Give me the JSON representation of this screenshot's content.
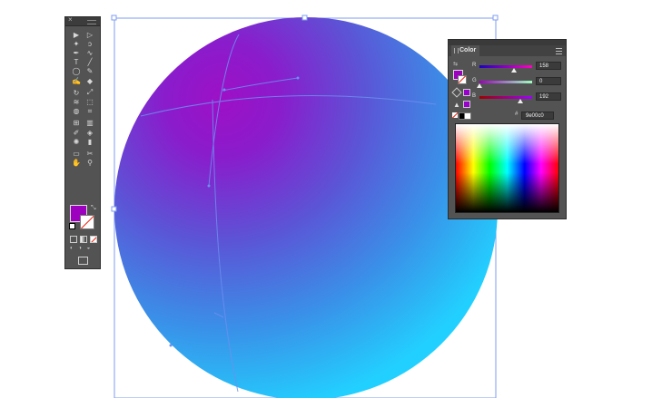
{
  "app": "Illustrator-style vector editor",
  "colors": {
    "fill": "#9e00c0",
    "gradient_highlight": "#9e10c6",
    "gradient_mid": "#5b55d6",
    "gradient_edge": "#28c4ff",
    "selection": "#5b8cf0"
  },
  "toolbar": {
    "close_glyph": "×",
    "tools": [
      "selection-tool",
      "direct-selection-tool",
      "magic-wand-tool",
      "lasso-tool",
      "pen-tool",
      "curvature-tool",
      "type-tool",
      "line-tool",
      "ellipse-tool",
      "paintbrush-tool",
      "shaper-tool",
      "eraser-tool",
      "rotate-tool",
      "scale-tool",
      "width-tool",
      "free-transform-tool",
      "shape-builder-tool",
      "perspective-grid-tool",
      "mesh-tool",
      "gradient-tool",
      "eyedropper-tool",
      "blend-tool",
      "symbol-sprayer-tool",
      "column-graph-tool",
      "artboard-tool",
      "slice-tool",
      "hand-tool",
      "zoom-tool"
    ]
  },
  "color_panel": {
    "tab_label": "Color",
    "channels": [
      {
        "label": "R",
        "value": "158"
      },
      {
        "label": "G",
        "value": "0"
      },
      {
        "label": "B",
        "value": "192"
      }
    ],
    "hex_value": "9e00c0",
    "hash": "#"
  }
}
